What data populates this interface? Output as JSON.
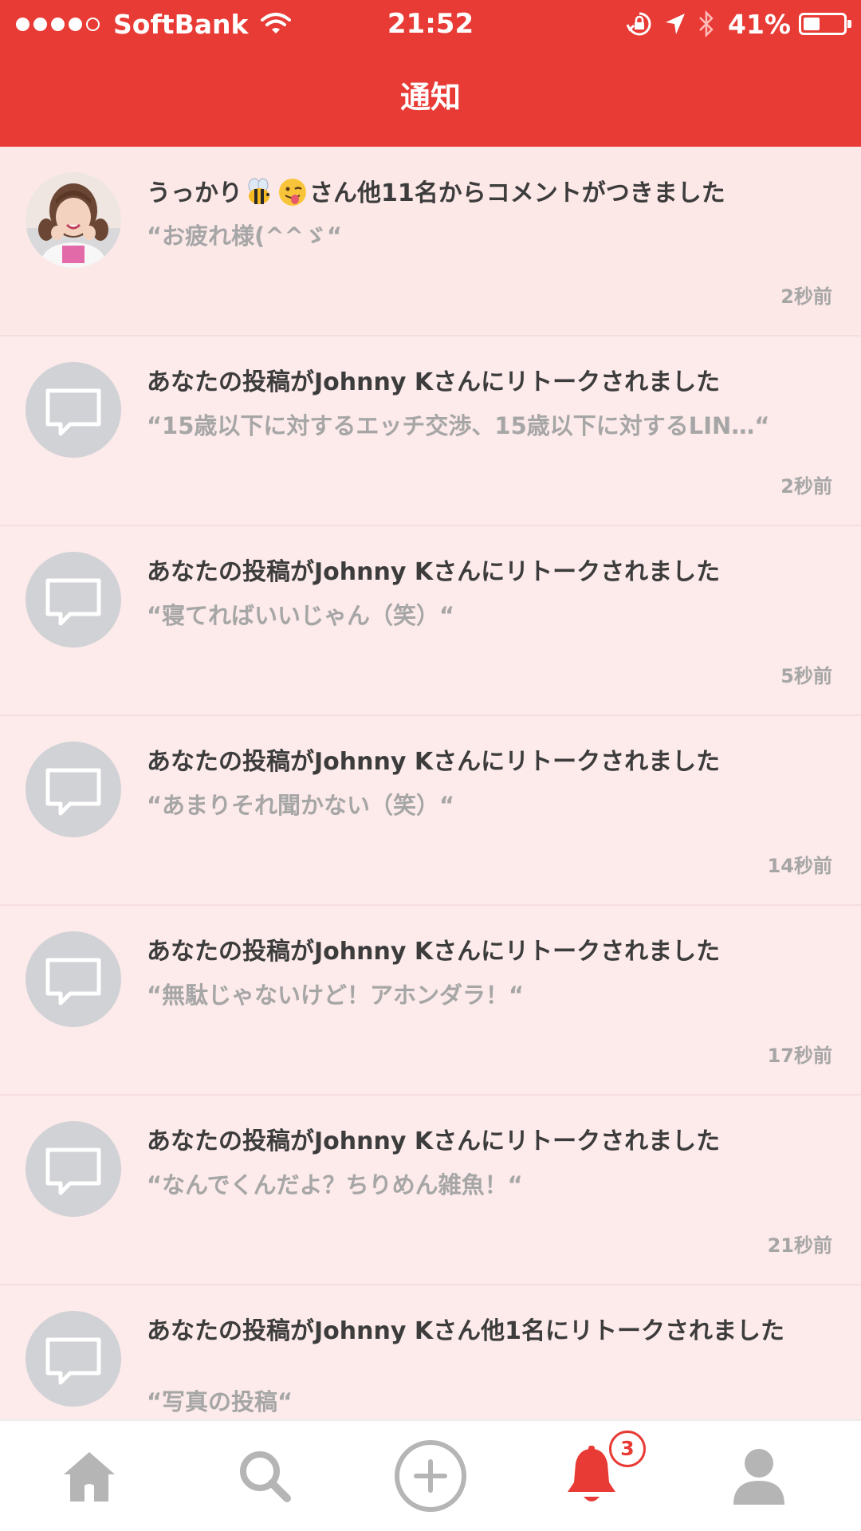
{
  "status_bar": {
    "carrier": "SoftBank",
    "time": "21:52",
    "battery": "41%",
    "battery_level": 0.41
  },
  "header": {
    "title": "通知",
    "background_color": "#e83b35"
  },
  "notifications": [
    {
      "avatar": "user-photo",
      "title_pre": "うっかり",
      "title_emojis": [
        "bee-emoji",
        "winking-tongue-emoji"
      ],
      "title_post": "さん他11名からコメントがつきました",
      "quote": "“お疲れ様(^^ゞ“",
      "time": "2秒前"
    },
    {
      "avatar": "speech-bubble-icon",
      "title": "あなたの投稿がJohnny Kさんにリトークされました",
      "quote": "“15歳以下に対するエッチ交渉、15歳以下に対するLIN…“",
      "time": "2秒前"
    },
    {
      "avatar": "speech-bubble-icon",
      "title": "あなたの投稿がJohnny Kさんにリトークされました",
      "quote": "“寝てればいいじゃん（笑）“",
      "time": "5秒前"
    },
    {
      "avatar": "speech-bubble-icon",
      "title": "あなたの投稿がJohnny Kさんにリトークされました",
      "quote": "“あまりそれ聞かない（笑）“",
      "time": "14秒前"
    },
    {
      "avatar": "speech-bubble-icon",
      "title": "あなたの投稿がJohnny Kさんにリトークされました",
      "quote": "“無駄じゃないけど！アホンダラ！“",
      "time": "17秒前"
    },
    {
      "avatar": "speech-bubble-icon",
      "title": "あなたの投稿がJohnny Kさんにリトークされました",
      "quote": "“なんでくんだよ？ちりめん雑魚！“",
      "time": "21秒前"
    },
    {
      "avatar": "speech-bubble-icon",
      "title": "あなたの投稿がJohnny Kさん他1名にリトークされました",
      "quote": "“写真の投稿“",
      "time": ""
    }
  ],
  "tabbar": {
    "tabs": [
      "home-icon",
      "search-icon",
      "add-post-icon",
      "bell-icon",
      "profile-icon"
    ],
    "active_tab": "bell-icon",
    "notification_badge": "3",
    "active_color": "#e83b35",
    "inactive_color": "#b5b5b5"
  }
}
